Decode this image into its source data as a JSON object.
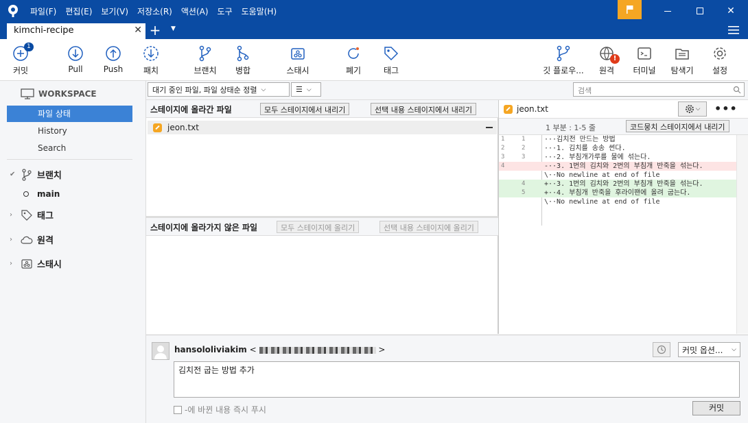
{
  "menus": [
    "파일(F)",
    "편집(E)",
    "보기(V)",
    "저장소(R)",
    "액션(A)",
    "도구",
    "도움말(H)"
  ],
  "tab": {
    "title": "kimchi-recipe",
    "close": "✕",
    "add": "+",
    "dropdown": "▼"
  },
  "toolbar": {
    "commit": "커밋",
    "commit_badge": "1",
    "pull": "Pull",
    "push": "Push",
    "fetch": "패치",
    "branch": "브랜치",
    "merge": "병합",
    "stash": "스태시",
    "discard": "폐기",
    "tag": "태그",
    "gitflow": "깃 플로우...",
    "remote": "원격",
    "remote_badge": "!",
    "terminal": "터미널",
    "explorer": "탐색기",
    "settings": "설정"
  },
  "sidebar": {
    "workspace": "WORKSPACE",
    "items": [
      "파일 상태",
      "History",
      "Search"
    ],
    "branches": "브랜치",
    "main_branch": "main",
    "tags": "태그",
    "remotes": "원격",
    "stashes": "스태시"
  },
  "filter": {
    "sort_label": "대기 중인 파일, 파일 상태순 정렬",
    "view_mode": "☰",
    "search_placeholder": "검색"
  },
  "staged": {
    "title": "스테이지에 올라간 파일",
    "unstage_all": "모두 스테이지에서 내리기",
    "unstage_selected": "선택 내용 스테이지에서 내리기",
    "files": [
      {
        "name": "jeon.txt"
      }
    ]
  },
  "unstaged": {
    "title": "스테이지에 올라가지 않은 파일",
    "stage_all": "모두 스테이지에 올리기",
    "stage_selected": "선택 내용 스테이지에 올리기"
  },
  "diff": {
    "file": "jeon.txt",
    "hunk": "1 부분 : 1-5 줄",
    "unstage_hunk": "코드뭉치 스테이지에서 내리기",
    "lines": [
      {
        "old": "1",
        "new": "1",
        "type": "ctx",
        "text": "···김치전 만드는 방법"
      },
      {
        "old": "2",
        "new": "2",
        "type": "ctx",
        "text": "···1. 김치를 송송 썬다."
      },
      {
        "old": "3",
        "new": "3",
        "type": "ctx",
        "text": "···2. 부침개가루를 물에 섞는다."
      },
      {
        "old": "4",
        "new": "",
        "type": "del",
        "text": "-··3. 1번의 김치와 2번의 부침개 반죽을 섞는다."
      },
      {
        "old": "",
        "new": "",
        "type": "ctx",
        "text": "\\··No newline at end of file"
      },
      {
        "old": "",
        "new": "4",
        "type": "add",
        "text": "+··3. 1번의 김치와 2번의 부침개 반죽을 섞는다."
      },
      {
        "old": "",
        "new": "5",
        "type": "add",
        "text": "+··4. 부침개 반죽을 후라이팬에 올려 굽는다."
      },
      {
        "old": "",
        "new": "",
        "type": "ctx",
        "text": "\\··No newline at end of file"
      }
    ]
  },
  "commit": {
    "author_name": "hansololiviakim",
    "author_open": "<",
    "author_close": ">",
    "message": "김치전 굽는 방법 추가",
    "options": "커밋 옵션...",
    "push_immediately": "-에 바뀐 내용 즉시 푸시",
    "commit_button": "커밋"
  },
  "colors": {
    "accent": "#0a4ba3",
    "active": "#3b82d6",
    "flag": "#f5a623"
  }
}
